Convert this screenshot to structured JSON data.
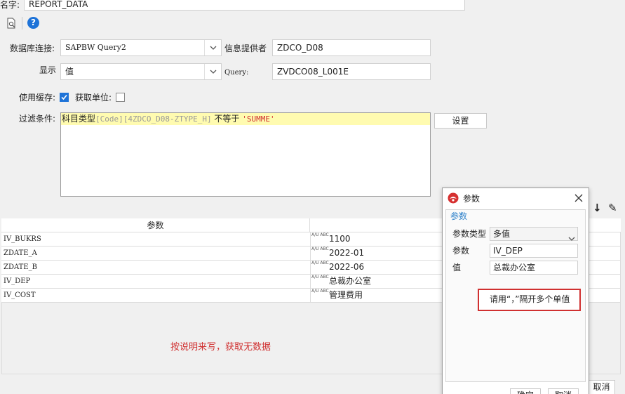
{
  "top": {
    "name_label": "名字:",
    "name_value": "REPORT_DATA"
  },
  "toolbar": {
    "help_glyph": "?"
  },
  "form": {
    "db_label": "数据库连接:",
    "db_value": "SAPBW Query2",
    "provider_label": "信息提供者",
    "provider_value": "ZDCO_D08",
    "display_label": "显示",
    "display_value": "值",
    "query_label": "Query:",
    "query_value": "ZVDCO08_L001E",
    "cache_label": "使用缓存:",
    "cache_checked": true,
    "unit_label": "获取单位:",
    "unit_checked": false,
    "filter_label": "过滤条件:",
    "filter_field": "科目类型",
    "filter_code": "[Code][4ZDCO_D08-ZTYPE_H]",
    "filter_op": "不等于",
    "filter_val": "'SUMME'",
    "settings_button": "设置"
  },
  "params_table": {
    "header": "参数",
    "type_badge": "A/U ABC",
    "rows": [
      {
        "name": "IV_BUKRS",
        "value": "1100"
      },
      {
        "name": "ZDATE_A",
        "value": "2022-01"
      },
      {
        "name": "ZDATE_B",
        "value": "2022-06"
      },
      {
        "name": "IV_DEP",
        "value": "总裁办公室"
      },
      {
        "name": "IV_COST",
        "value": "管理费用"
      }
    ],
    "annotation": "按说明来写，获取无数据"
  },
  "right_tools": {
    "down_glyph": "↓",
    "edit_glyph": "✎"
  },
  "dialog": {
    "title": "参数",
    "section": "参数",
    "type_label": "参数类型",
    "type_value": "多值",
    "param_label": "参数",
    "param_value": "IV_DEP",
    "value_label": "值",
    "value_value": "总裁办公室",
    "hint": "请用“，”隔开多个单值",
    "ok_button": "确定",
    "cancel_button": "取消"
  },
  "bottom": {
    "cancel_button": "取消"
  },
  "colors": {
    "filter_highlight": "#fffbb0",
    "code_gray": "#9a9a9a",
    "string_red": "#d03030",
    "annotation_red": "#d03030",
    "accent_blue": "#1e73d8",
    "dialog_section": "#2a7fc9"
  }
}
